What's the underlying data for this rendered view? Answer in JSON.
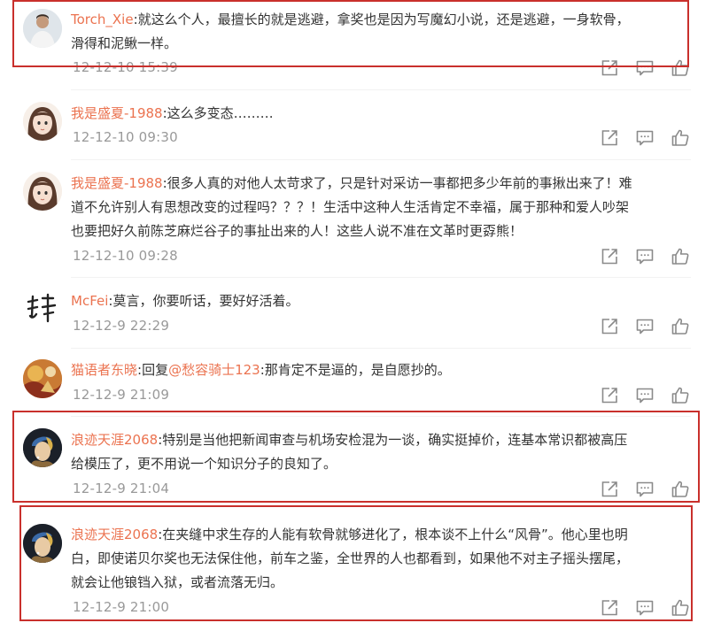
{
  "colors": {
    "username": "#eb7350",
    "text": "#333333",
    "timestamp": "#999999",
    "highlight_box": "#c9302c"
  },
  "comments": [
    {
      "user": "Torch_Xie",
      "text": "就这么个人，最擅长的就是逃避，拿奖也是因为写魔幻小说，还是逃避，一身软骨，滑得和泥鳅一样。",
      "line1": "就这么个人，最擅长的就是逃避，拿奖也是因为写魔幻小说，还是逃避，一身软骨，",
      "line2": "滑得和泥鳅一样。",
      "time": "12-12-10 15:39",
      "avatar_icon": "person-photo-avatar"
    },
    {
      "user": "我是盛夏-1988",
      "line1": "这么多变态………",
      "time": "12-12-10 09:30",
      "avatar_icon": "cartoon-girl-avatar"
    },
    {
      "user": "我是盛夏-1988",
      "line1": "很多人真的对他人太苛求了，只是针对采访一事都把多少年前的事揪出来了！难",
      "line2": "道不允许别人有思想改变的过程吗？？？！生活中这种人生活肯定不幸福，属于那种和爱人吵架",
      "line3": "也要把好久前陈芝麻烂谷子的事扯出来的人！这些人说不准在文革时更孬熊！",
      "time": "12-12-10 09:28",
      "avatar_icon": "cartoon-girl-avatar"
    },
    {
      "user": "McFei",
      "line1": "莫言，你要听话，要好好活着。",
      "time": "12-12-9 22:29",
      "avatar_icon": "calligraphy-avatar"
    },
    {
      "user": "猫语者东晓",
      "reply_prefix": "回复",
      "mention": "@愁容骑士123",
      "line1": "那肯定不是逼的，是自愿抄的。",
      "time": "12-12-9 21:09",
      "avatar_icon": "painting-avatar"
    },
    {
      "user": "浪迹天涯2068",
      "line1": "特别是当他把新闻审查与机场安检混为一谈，确实挺掉价，连基本常识都被高压",
      "line2": "给模压了，更不用说一个知识分子的良知了。",
      "time": "12-12-9 21:04",
      "avatar_icon": "pearl-earring-girl-avatar"
    },
    {
      "user": "浪迹天涯2068",
      "line1": "在夹缝中求生存的人能有软骨就够进化了，根本谈不上什么“风骨”。他心里也明",
      "line2": "白，即使诺贝尔奖也无法保住他，前车之鉴，全世界的人也都看到，如果他不对主子摇头摆尾，",
      "line3": "就会让他锒铛入狱，或者流落无归。",
      "time": "12-12-9 21:00",
      "avatar_icon": "pearl-earring-girl-avatar"
    }
  ],
  "actions": [
    "share-icon",
    "comment-icon",
    "like-icon"
  ]
}
